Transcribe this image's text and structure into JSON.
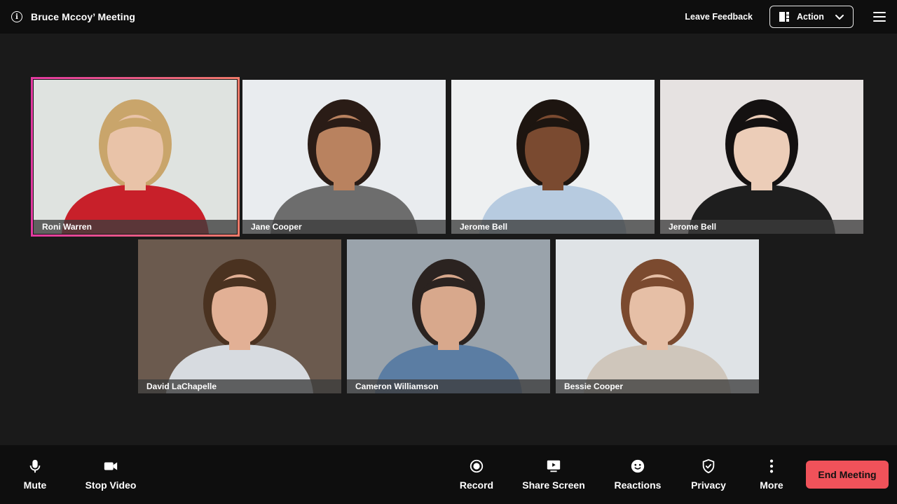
{
  "header": {
    "meeting_title": "Bruce Mccoy’ Meeting",
    "feedback_label": "Leave Feedback",
    "action_label": "Action"
  },
  "participants": [
    {
      "name": "Roni Warren",
      "bg": "#dfe3e0",
      "skin": "#e9c3a8",
      "hair": "#c9a56b",
      "shirt": "#c8202a",
      "active": true
    },
    {
      "name": "Jane Cooper",
      "bg": "#e9ecef",
      "skin": "#b9825f",
      "hair": "#2a1c16",
      "shirt": "#6d6d6d",
      "active": false
    },
    {
      "name": "Jerome Bell",
      "bg": "#eef0f1",
      "skin": "#7a4a30",
      "hair": "#1d1510",
      "shirt": "#b7cbe0",
      "active": false
    },
    {
      "name": "Jerome Bell",
      "bg": "#e6e2e1",
      "skin": "#eccdb8",
      "hair": "#141111",
      "shirt": "#1e1e1e",
      "active": false
    },
    {
      "name": "David LaChapelle",
      "bg": "#6b5a4e",
      "skin": "#e2b095",
      "hair": "#4a3220",
      "shirt": "#d7dbe0",
      "active": false
    },
    {
      "name": "Cameron Williamson",
      "bg": "#9aa3ab",
      "skin": "#d8a88c",
      "hair": "#2b2320",
      "shirt": "#5b7da3",
      "active": false
    },
    {
      "name": "Bessie Cooper",
      "bg": "#dfe3e6",
      "skin": "#e6bfa6",
      "hair": "#7b4a2f",
      "shirt": "#cfc6bb",
      "active": false
    }
  ],
  "controls": {
    "mute": "Mute",
    "stop_video": "Stop Video",
    "record": "Record",
    "share_screen": "Share Screen",
    "reactions": "Reactions",
    "privacy": "Privacy",
    "more": "More",
    "end_meeting": "End Meeting"
  },
  "colors": {
    "end_button": "#f0525a",
    "active_speaker_start": "#e23aa0",
    "active_speaker_end": "#f07a6a"
  }
}
